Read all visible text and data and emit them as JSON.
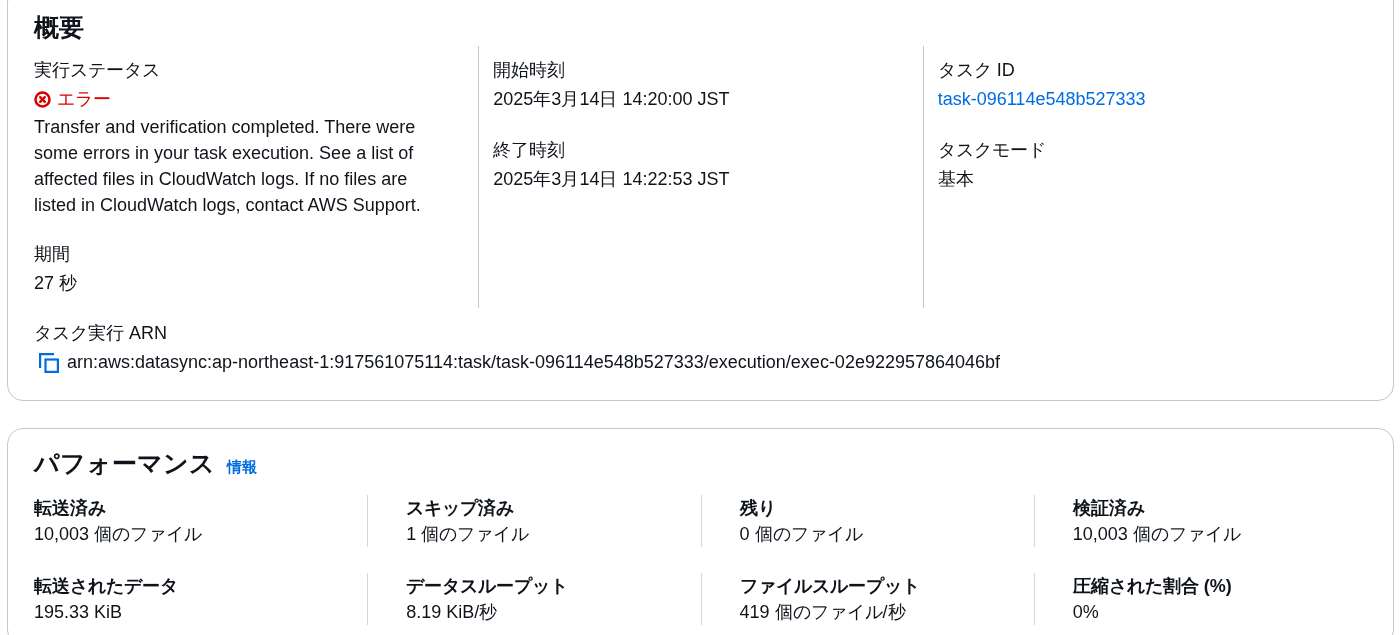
{
  "overview": {
    "title": "概要",
    "columns": [
      [
        {
          "kind": "status",
          "label": "実行ステータス",
          "error": true,
          "value": "エラー",
          "description": "Transfer and verification completed. There were some errors in your task execution. See a list of affected files in CloudWatch logs. If no files are listed in CloudWatch logs, contact AWS Support."
        },
        {
          "kind": "text",
          "label": "期間",
          "value": "27 秒"
        }
      ],
      [
        {
          "kind": "text",
          "label": "開始時刻",
          "value": "2025年3月14日 14:20:00 JST"
        },
        {
          "kind": "text",
          "label": "終了時刻",
          "value": "2025年3月14日 14:22:53 JST"
        }
      ],
      [
        {
          "kind": "link",
          "label": "タスク ID",
          "value": "task-096114e548b527333"
        },
        {
          "kind": "text",
          "label": "タスクモード",
          "value": "基本"
        }
      ]
    ],
    "arn": {
      "label": "タスク実行 ARN",
      "value": "arn:aws:datasync:ap-northeast-1:917561075114:task/task-096114e548b527333/execution/exec-02e922957864046bf"
    }
  },
  "performance": {
    "title": "パフォーマンス",
    "info_link": "情報",
    "metrics": [
      {
        "label": "転送済み",
        "value": "10,003 個のファイル"
      },
      {
        "label": "スキップ済み",
        "value": "1 個のファイル"
      },
      {
        "label": "残り",
        "value": "0 個のファイル"
      },
      {
        "label": "検証済み",
        "value": "10,003 個のファイル"
      },
      {
        "label": "転送されたデータ",
        "value": "195.33 KiB"
      },
      {
        "label": "データスループット",
        "value": "8.19 KiB/秒"
      },
      {
        "label": "ファイルスループット",
        "value": "419 個のファイル/秒"
      },
      {
        "label": "圧縮された割合 (%)",
        "value": "0%"
      }
    ]
  }
}
